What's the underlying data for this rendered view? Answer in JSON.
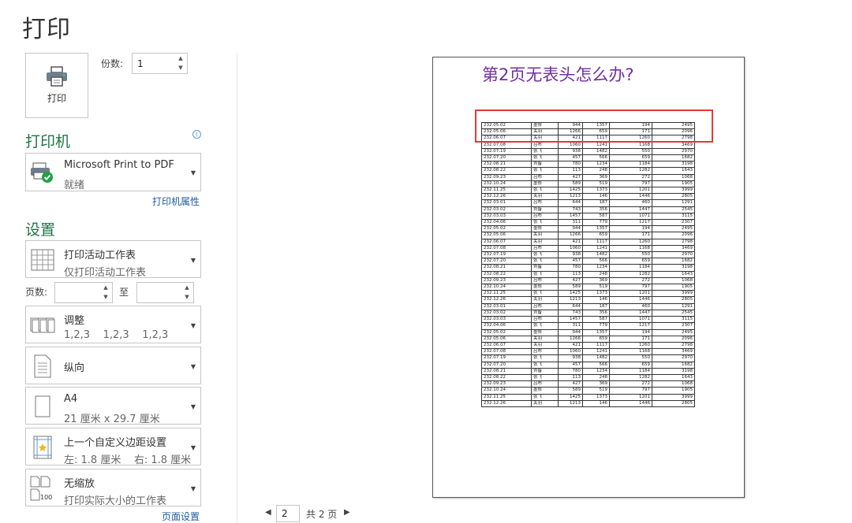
{
  "page_title": "打印",
  "print_button": {
    "label": "打印"
  },
  "copies": {
    "label": "份数:",
    "value": "1"
  },
  "printer": {
    "heading": "打印机",
    "name": "Microsoft Print to PDF",
    "status": "就绪",
    "properties_link": "打印机属性"
  },
  "settings": {
    "heading": "设置",
    "scope": {
      "main": "打印活动工作表",
      "sub": "仅打印活动工作表"
    },
    "pages_label": "页数:",
    "to_label": "至",
    "collate": {
      "main": "调整",
      "sub": "1,2,3    1,2,3    1,2,3"
    },
    "orientation": {
      "main": "纵向"
    },
    "paper": {
      "main": "A4",
      "sub": "21 厘米 x 29.7 厘米"
    },
    "margins": {
      "main": "上一个自定义边距设置",
      "sub": "左: 1.8 厘米    右: 1.8 厘米"
    },
    "scaling": {
      "main": "无缩放",
      "sub": "打印实际大小的工作表"
    },
    "page_setup_link": "页面设置"
  },
  "preview": {
    "title": "第2页无表头怎么办?",
    "rows": [
      [
        "232.05.02",
        "墨修",
        "944",
        "1357",
        "194",
        "2495"
      ],
      [
        "232.05.06",
        "关羽",
        "1266",
        "659",
        "171",
        "2096"
      ],
      [
        "232.06.07",
        "关羽",
        "421",
        "1117",
        "1260",
        "2798"
      ],
      [
        "232.07.08",
        "吕布",
        "1060",
        "1241",
        "1168",
        "3469"
      ],
      [
        "232.07.19",
        "张飞",
        "938",
        "1482",
        "550",
        "2970"
      ],
      [
        "232.07.20",
        "张飞",
        "457",
        "566",
        "659",
        "1682"
      ],
      [
        "232.08.21",
        "刘备",
        "780",
        "1234",
        "1184",
        "3198"
      ],
      [
        "232.08.22",
        "张飞",
        "113",
        "248",
        "1282",
        "1643"
      ],
      [
        "232.09.23",
        "吕布",
        "427",
        "369",
        "272",
        "1068"
      ],
      [
        "232.10.24",
        "墨修",
        "589",
        "519",
        "797",
        "1905"
      ],
      [
        "232.11.25",
        "张飞",
        "1425",
        "1373",
        "1201",
        "3999"
      ],
      [
        "232.12.26",
        "关羽",
        "1213",
        "146",
        "1446",
        "2805"
      ],
      [
        "232.03.01",
        "吕布",
        "644",
        "187",
        "460",
        "1291"
      ],
      [
        "232.03.02",
        "刘备",
        "743",
        "356",
        "1447",
        "2545"
      ],
      [
        "232.03.03",
        "吕布",
        "1457",
        "587",
        "1071",
        "3115"
      ],
      [
        "232.04.06",
        "张飞",
        "311",
        "779",
        "1217",
        "2307"
      ],
      [
        "232.05.02",
        "墨修",
        "944",
        "1357",
        "194",
        "2495"
      ],
      [
        "232.05.06",
        "关羽",
        "1266",
        "659",
        "171",
        "2096"
      ],
      [
        "232.06.07",
        "关羽",
        "421",
        "1117",
        "1260",
        "2798"
      ],
      [
        "232.07.08",
        "吕布",
        "1060",
        "1241",
        "1168",
        "3469"
      ],
      [
        "232.07.19",
        "张飞",
        "938",
        "1482",
        "550",
        "2970"
      ],
      [
        "232.07.20",
        "张飞",
        "457",
        "566",
        "659",
        "1682"
      ],
      [
        "232.08.21",
        "刘备",
        "780",
        "1234",
        "1184",
        "3198"
      ],
      [
        "232.08.22",
        "张飞",
        "113",
        "248",
        "1282",
        "1643"
      ],
      [
        "232.09.23",
        "吕布",
        "427",
        "369",
        "272",
        "1068"
      ],
      [
        "232.10.24",
        "墨修",
        "589",
        "519",
        "797",
        "1905"
      ],
      [
        "232.11.25",
        "张飞",
        "1425",
        "1373",
        "1201",
        "3999"
      ],
      [
        "232.12.26",
        "关羽",
        "1213",
        "146",
        "1446",
        "2805"
      ],
      [
        "232.03.01",
        "吕布",
        "644",
        "187",
        "460",
        "1291"
      ],
      [
        "232.03.02",
        "刘备",
        "743",
        "356",
        "1447",
        "2545"
      ],
      [
        "232.03.03",
        "吕布",
        "1457",
        "587",
        "1071",
        "3115"
      ],
      [
        "232.04.06",
        "张飞",
        "311",
        "779",
        "1217",
        "2307"
      ],
      [
        "232.05.02",
        "墨修",
        "944",
        "1357",
        "194",
        "2495"
      ],
      [
        "232.05.06",
        "关羽",
        "1266",
        "659",
        "171",
        "2096"
      ],
      [
        "232.06.07",
        "关羽",
        "421",
        "1117",
        "1260",
        "2798"
      ],
      [
        "232.07.08",
        "吕布",
        "1060",
        "1241",
        "1168",
        "3469"
      ],
      [
        "232.07.19",
        "张飞",
        "938",
        "1482",
        "550",
        "2970"
      ],
      [
        "232.07.20",
        "张飞",
        "457",
        "566",
        "659",
        "1682"
      ],
      [
        "232.08.21",
        "刘备",
        "780",
        "1234",
        "1184",
        "3198"
      ],
      [
        "232.08.22",
        "张飞",
        "113",
        "248",
        "1282",
        "1643"
      ],
      [
        "232.09.23",
        "吕布",
        "427",
        "369",
        "272",
        "1068"
      ],
      [
        "232.10.24",
        "墨修",
        "589",
        "519",
        "797",
        "1905"
      ],
      [
        "232.11.25",
        "张飞",
        "1425",
        "1373",
        "1201",
        "3999"
      ],
      [
        "232.12.26",
        "关羽",
        "1213",
        "146",
        "1446",
        "2805"
      ]
    ]
  },
  "pager": {
    "current": "2",
    "total": "共 2 页"
  },
  "colors": {
    "accent_green": "#217346",
    "title_purple": "#7030a0",
    "highlight_red": "#e53935",
    "link_blue": "#1e5b9e"
  }
}
